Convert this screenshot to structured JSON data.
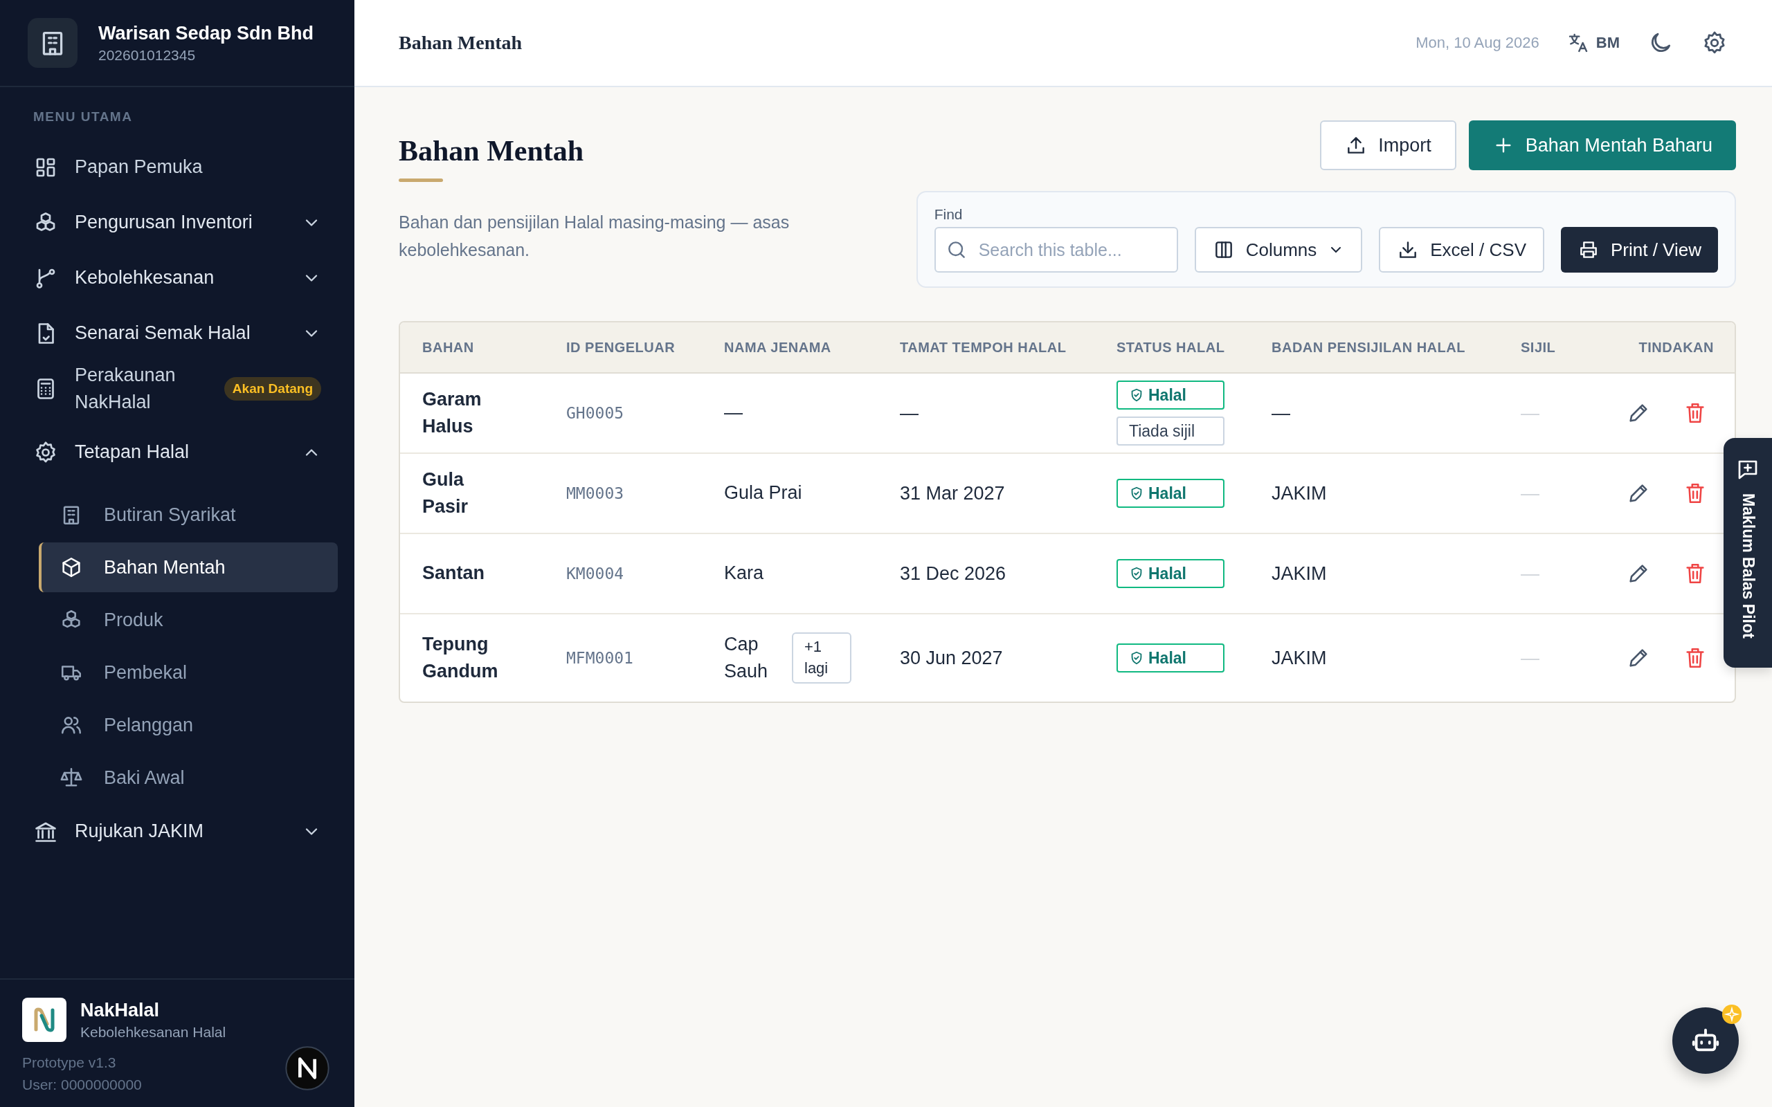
{
  "company": {
    "name": "Warisan Sedap Sdn Bhd",
    "reg_no": "202601012345"
  },
  "sidebar": {
    "section_label": "MENU UTAMA",
    "items": [
      {
        "label": "Papan Pemuka",
        "selected": false
      },
      {
        "label": "Pengurusan Inventori",
        "selected": false,
        "expanded": false
      },
      {
        "label": "Kebolehkesanan",
        "selected": false,
        "expanded": false
      },
      {
        "label": "Senarai Semak Halal",
        "selected": false,
        "expanded": false
      },
      {
        "label": "Perakaunan NakHalal",
        "selected": false,
        "badge": "Akan Datang"
      },
      {
        "label": "Tetapan Halal",
        "selected": false,
        "expanded": true,
        "children": [
          {
            "label": "Butiran Syarikat",
            "selected": false
          },
          {
            "label": "Bahan Mentah",
            "selected": true
          },
          {
            "label": "Produk",
            "selected": false
          },
          {
            "label": "Pembekal",
            "selected": false
          },
          {
            "label": "Pelanggan",
            "selected": false
          },
          {
            "label": "Baki Awal",
            "selected": false
          }
        ]
      },
      {
        "label": "Rujukan JAKIM",
        "selected": false,
        "expanded": false
      }
    ]
  },
  "footer": {
    "app_name": "NakHalal",
    "tagline": "Kebolehkesanan Halal",
    "version": "Prototype v1.3",
    "user": "User: 0000000000"
  },
  "header": {
    "title": "Bahan Mentah",
    "date": "Mon, 10 Aug 2026",
    "language": "BM"
  },
  "page": {
    "title": "Bahan Mentah",
    "description": "Bahan dan pensijilan Halal masing-masing — asas kebolehkesanan.",
    "buttons": [
      {
        "label": "Import",
        "kind": "secondary"
      },
      {
        "label": "Bahan Mentah Baharu",
        "kind": "primary"
      }
    ]
  },
  "toolbar": {
    "find_label": "Find",
    "search": {
      "placeholder": "Search this table..."
    },
    "buttons": [
      {
        "label": "Columns",
        "kind": "columns"
      },
      {
        "label": "Excel / CSV",
        "kind": "export"
      },
      {
        "label": "Print / View",
        "kind": "print"
      }
    ]
  },
  "table": {
    "columns": [
      "BAHAN",
      "ID PENGELUAR",
      "NAMA JENAMA",
      "TAMAT TEMPOH HALAL",
      "STATUS HALAL",
      "BADAN PENSIJILAN HALAL",
      "SIJIL",
      "TINDAKAN"
    ],
    "rows": [
      {
        "name": "Garam Halus",
        "id": "GH0005",
        "brand": "—",
        "expiry": "—",
        "status": [
          {
            "label": "Halal",
            "kind": "halal"
          },
          {
            "label": "Tiada sijil",
            "kind": "none"
          }
        ],
        "body": "—",
        "cert": "—"
      },
      {
        "name": "Gula Pasir",
        "id": "MM0003",
        "brand": "Gula Prai",
        "expiry": "31 Mar 2027",
        "status": [
          {
            "label": "Halal",
            "kind": "halal"
          }
        ],
        "body": "JAKIM",
        "cert": "—"
      },
      {
        "name": "Santan",
        "id": "KM0004",
        "brand": "Kara",
        "expiry": "31 Dec 2026",
        "status": [
          {
            "label": "Halal",
            "kind": "halal"
          }
        ],
        "body": "JAKIM",
        "cert": "—"
      },
      {
        "name": "Tepung Gandum",
        "id": "MFM0001",
        "brand": "Cap Sauh",
        "more": "+1 lagi",
        "expiry": "30 Jun 2027",
        "status": [
          {
            "label": "Halal",
            "kind": "halal"
          }
        ],
        "body": "JAKIM",
        "cert": "—"
      }
    ]
  },
  "feedback_tab": {
    "label": "Maklum Balas Pilot"
  }
}
